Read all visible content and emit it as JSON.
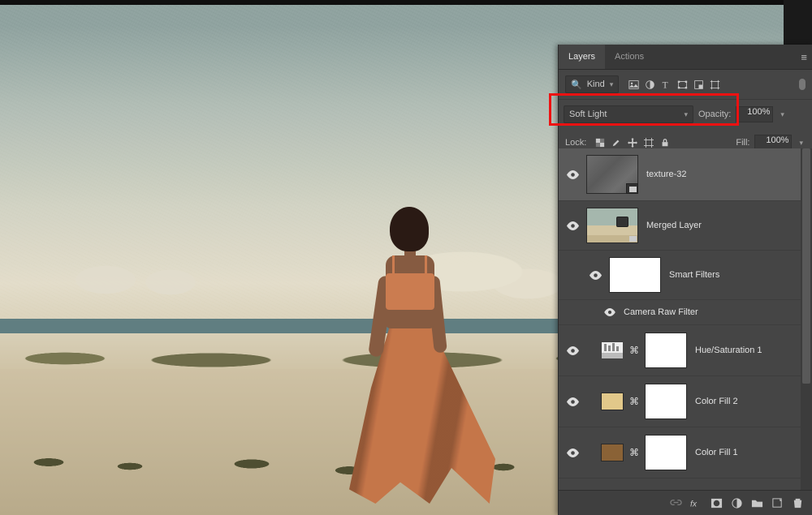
{
  "panel": {
    "tabs": {
      "layers": "Layers",
      "actions": "Actions"
    },
    "kind_label": "Kind",
    "blend_mode": "Soft Light",
    "opacity_label": "Opacity:",
    "opacity_value": "100%",
    "lock_label": "Lock:",
    "fill_label": "Fill:",
    "fill_value": "100%",
    "filter_icons": [
      "image",
      "adjustment",
      "type",
      "shape",
      "smart-object",
      "artboard"
    ],
    "lock_icons": [
      "pixels",
      "brush",
      "move",
      "crop",
      "all"
    ]
  },
  "layers": [
    {
      "id": "texture",
      "name": "texture-32",
      "kind": "smart",
      "thumb": "t-texture",
      "selected": true
    },
    {
      "id": "merged",
      "name": "Merged Layer",
      "kind": "smart",
      "thumb": "t-merged",
      "selected": false
    },
    {
      "id": "smartfilt",
      "name": "Smart Filters",
      "kind": "sf-head",
      "thumb": "t-sf",
      "selected": false
    },
    {
      "id": "craw",
      "name": "Camera Raw Filter",
      "kind": "sf-item",
      "selected": false
    },
    {
      "id": "hs",
      "name": "Hue/Saturation 1",
      "kind": "adj",
      "icon": "hs",
      "mask": true,
      "selected": false
    },
    {
      "id": "cf2",
      "name": "Color Fill 2",
      "kind": "adj",
      "icon": "solid",
      "swatch": "#e2c88a",
      "mask": true,
      "selected": false
    },
    {
      "id": "cf1",
      "name": "Color Fill 1",
      "kind": "adj",
      "icon": "solid",
      "swatch": "#8a6236",
      "mask": true,
      "selected": false
    }
  ],
  "bottom_icons": [
    "link",
    "fx",
    "mask",
    "adjustment",
    "group",
    "new",
    "trash"
  ]
}
